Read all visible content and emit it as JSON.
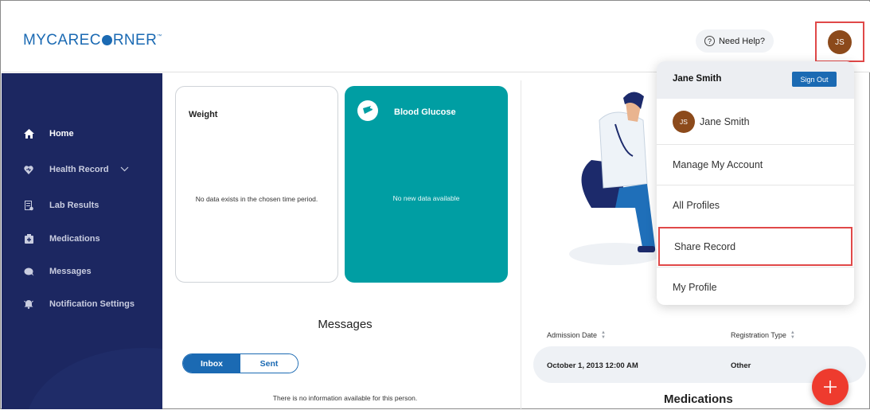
{
  "header": {
    "logo_text_before": "MYCAREC",
    "logo_text_after": "RNER",
    "logo_tm": "™",
    "help_label": "Need Help?",
    "help_glyph": "?",
    "avatar_initials": "JS"
  },
  "sidebar": {
    "items": [
      {
        "label": "Home",
        "icon": "home-icon"
      },
      {
        "label": "Health Record",
        "icon": "heart-icon"
      },
      {
        "label": "Lab Results",
        "icon": "lab-icon"
      },
      {
        "label": "Medications",
        "icon": "medications-icon"
      },
      {
        "label": "Messages",
        "icon": "chat-icon"
      },
      {
        "label": "Notification Settings",
        "icon": "bell-icon"
      }
    ]
  },
  "cards": {
    "weight": {
      "title": "Weight",
      "empty": "No data exists in the chosen time period."
    },
    "blood_glucose": {
      "title": "Blood Glucose",
      "empty": "No new data available"
    }
  },
  "messages": {
    "title": "Messages",
    "tabs": [
      "Inbox",
      "Sent"
    ],
    "empty": "There is no information available for this person."
  },
  "admissions": {
    "columns": [
      "Admission Date",
      "Registration Type"
    ],
    "rows": [
      [
        "October 1, 2013 12:00 AM",
        "Other"
      ]
    ]
  },
  "medications": {
    "title": "Medications"
  },
  "user_menu": {
    "name": "Jane Smith",
    "sign_out": "Sign Out",
    "profile_initials": "JS",
    "profile_name": "Jane Smith",
    "items": [
      "Manage My Account",
      "All Profiles",
      "Share Record",
      "My Profile"
    ]
  },
  "colors": {
    "brand": "#1b6ab3",
    "sidebar": "#1c2761",
    "glucose_card": "#009ea3",
    "fab": "#ee3b2e",
    "avatar": "#8c4a1b",
    "highlight": "#e04848"
  }
}
